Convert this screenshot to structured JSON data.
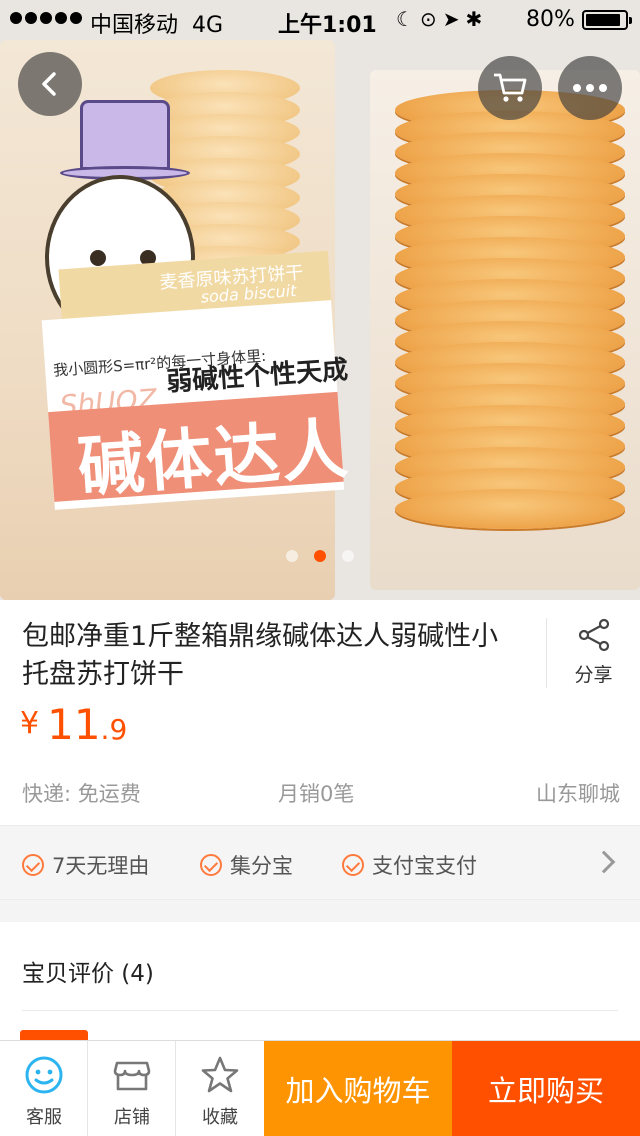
{
  "status_bar": {
    "carrier": "中国移动",
    "network": "4G",
    "time": "上午1:01",
    "battery": "80%"
  },
  "hero": {
    "label_small": "麦香原味苏打饼干",
    "label_sub": "soda biscuit",
    "label_line1": "我小圆形S=πr²的每一寸身体里:",
    "label_line2": "弱碱性个性天成",
    "label_big": "碱体达人",
    "label_ghost": "ShUOZ",
    "carousel_count": 3,
    "carousel_active": 2
  },
  "nav": {
    "back_icon": "chevron-left-icon",
    "cart_icon": "cart-icon",
    "more_icon": "more-dots-icon"
  },
  "product": {
    "title": "包邮净重1斤整箱鼎缘碱体达人弱碱性小托盘苏打饼干",
    "share_label": "分享",
    "price_symbol": "¥",
    "price_int": "11",
    "price_dec": ".9",
    "shipping": "快递: 免运费",
    "monthly_sales": "月销0笔",
    "location": "山东聊城"
  },
  "services": {
    "items": [
      "7天无理由",
      "集分宝",
      "支付宝支付"
    ]
  },
  "reviews": {
    "heading": "宝贝评价 (4)"
  },
  "bottom_bar": {
    "service_label": "客服",
    "shop_label": "店铺",
    "favorite_label": "收藏",
    "add_to_cart": "加入购物车",
    "buy_now": "立即购买"
  },
  "colors": {
    "accent": "#ff5000",
    "cart_button": "#ff9402",
    "service_icon": "#2cb4f0"
  }
}
